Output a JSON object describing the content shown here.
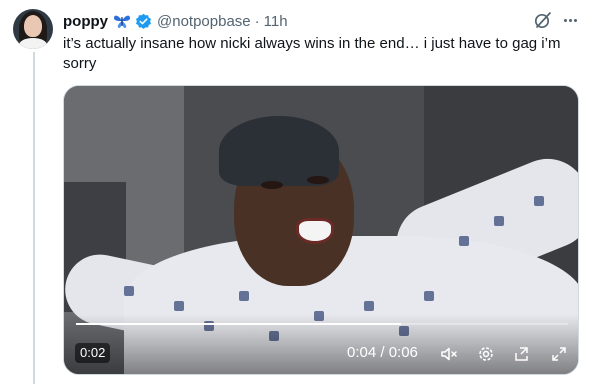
{
  "tweet": {
    "display_name": "poppy",
    "name_emoji": "butterfly-icon",
    "verified": true,
    "handle": "@notpopbase",
    "separator": "·",
    "time": "11h",
    "text": "it’s actually insane how nicki always wins in the end… i just have to gag i’m sorry"
  },
  "video": {
    "elapsed_badge": "0:02",
    "timecode": "0:04 / 0:06",
    "progress": 0.66,
    "controls": [
      "mute-icon",
      "settings-icon",
      "popout-icon",
      "fullscreen-icon"
    ]
  },
  "colors": {
    "text": "#0f1419",
    "secondary": "#536471",
    "verified": "#1d9bf0",
    "butterfly": "#2a6fdb",
    "border": "#cfd9de"
  }
}
